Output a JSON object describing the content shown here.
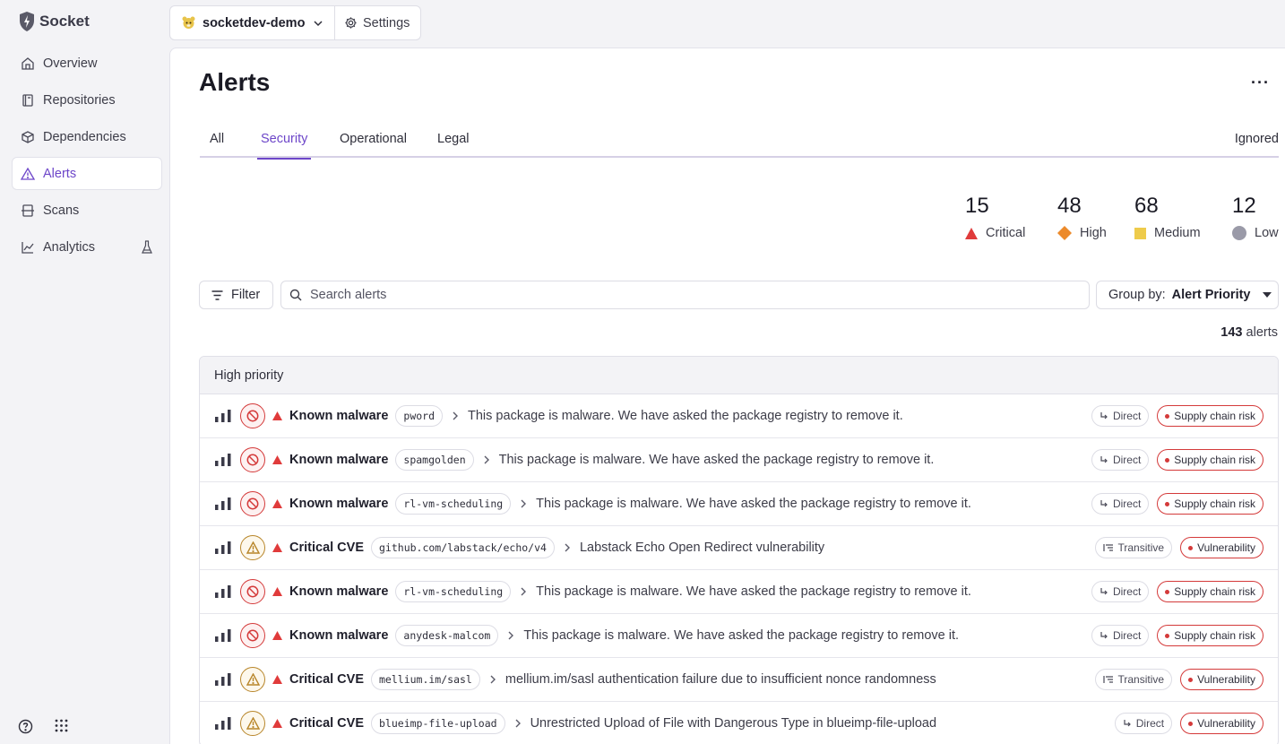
{
  "app": {
    "name": "Socket"
  },
  "sidebar": {
    "items": [
      {
        "label": "Overview",
        "icon": "home-icon"
      },
      {
        "label": "Repositories",
        "icon": "book-icon"
      },
      {
        "label": "Dependencies",
        "icon": "box-icon"
      },
      {
        "label": "Alerts",
        "icon": "warning-icon",
        "active": true
      },
      {
        "label": "Scans",
        "icon": "scan-icon"
      },
      {
        "label": "Analytics",
        "icon": "chart-icon",
        "badge_icon": "flask-icon"
      }
    ],
    "bottom": [
      "help-icon",
      "apps-grid-icon"
    ]
  },
  "topbar": {
    "workspace": "socketdev-demo",
    "settings_label": "Settings"
  },
  "page": {
    "title": "Alerts",
    "more_label": "···"
  },
  "tabs": [
    {
      "label": "All"
    },
    {
      "label": "Security",
      "active": true
    },
    {
      "label": "Operational"
    },
    {
      "label": "Legal"
    }
  ],
  "ignored_label": "Ignored",
  "severity_counts": [
    {
      "count": "15",
      "label": "Critical",
      "color": "#e03b3b"
    },
    {
      "count": "48",
      "label": "High",
      "color": "#ec8a2b"
    },
    {
      "count": "68",
      "label": "Medium",
      "color": "#eecb4b"
    },
    {
      "count": "12",
      "label": "Low",
      "color": "#9a9aa8"
    }
  ],
  "toolbar": {
    "filter_label": "Filter",
    "search_placeholder": "Search alerts",
    "groupby_prefix": "Group by:",
    "groupby_value": "Alert Priority"
  },
  "total": {
    "count": "143",
    "suffix": "alerts"
  },
  "group": {
    "title": "High priority"
  },
  "rows": [
    {
      "kind": "malware",
      "type": "Known malware",
      "package": "pword",
      "description": "This package is malware. We have asked the package registry to remove it.",
      "dep": "Direct",
      "category": "Supply chain risk"
    },
    {
      "kind": "malware",
      "type": "Known malware",
      "package": "spamgolden",
      "description": "This package is malware. We have asked the package registry to remove it.",
      "dep": "Direct",
      "category": "Supply chain risk"
    },
    {
      "kind": "malware",
      "type": "Known malware",
      "package": "rl-vm-scheduling",
      "description": "This package is malware. We have asked the package registry to remove it.",
      "dep": "Direct",
      "category": "Supply chain risk"
    },
    {
      "kind": "cve",
      "type": "Critical CVE",
      "package": "github.com/labstack/echo/v4",
      "description": "Labstack Echo Open Redirect vulnerability",
      "dep": "Transitive",
      "category": "Vulnerability"
    },
    {
      "kind": "malware",
      "type": "Known malware",
      "package": "rl-vm-scheduling",
      "description": "This package is malware. We have asked the package registry to remove it.",
      "dep": "Direct",
      "category": "Supply chain risk"
    },
    {
      "kind": "malware",
      "type": "Known malware",
      "package": "anydesk-malcom",
      "description": "This package is malware. We have asked the package registry to remove it.",
      "dep": "Direct",
      "category": "Supply chain risk"
    },
    {
      "kind": "cve",
      "type": "Critical CVE",
      "package": "mellium.im/sasl",
      "description": "mellium.im/sasl authentication failure due to insufficient nonce randomness",
      "dep": "Transitive",
      "category": "Vulnerability"
    },
    {
      "kind": "cve",
      "type": "Critical CVE",
      "package": "blueimp-file-upload",
      "description": "Unrestricted Upload of File with Dangerous Type in blueimp-file-upload",
      "dep": "Direct",
      "category": "Vulnerability"
    }
  ]
}
